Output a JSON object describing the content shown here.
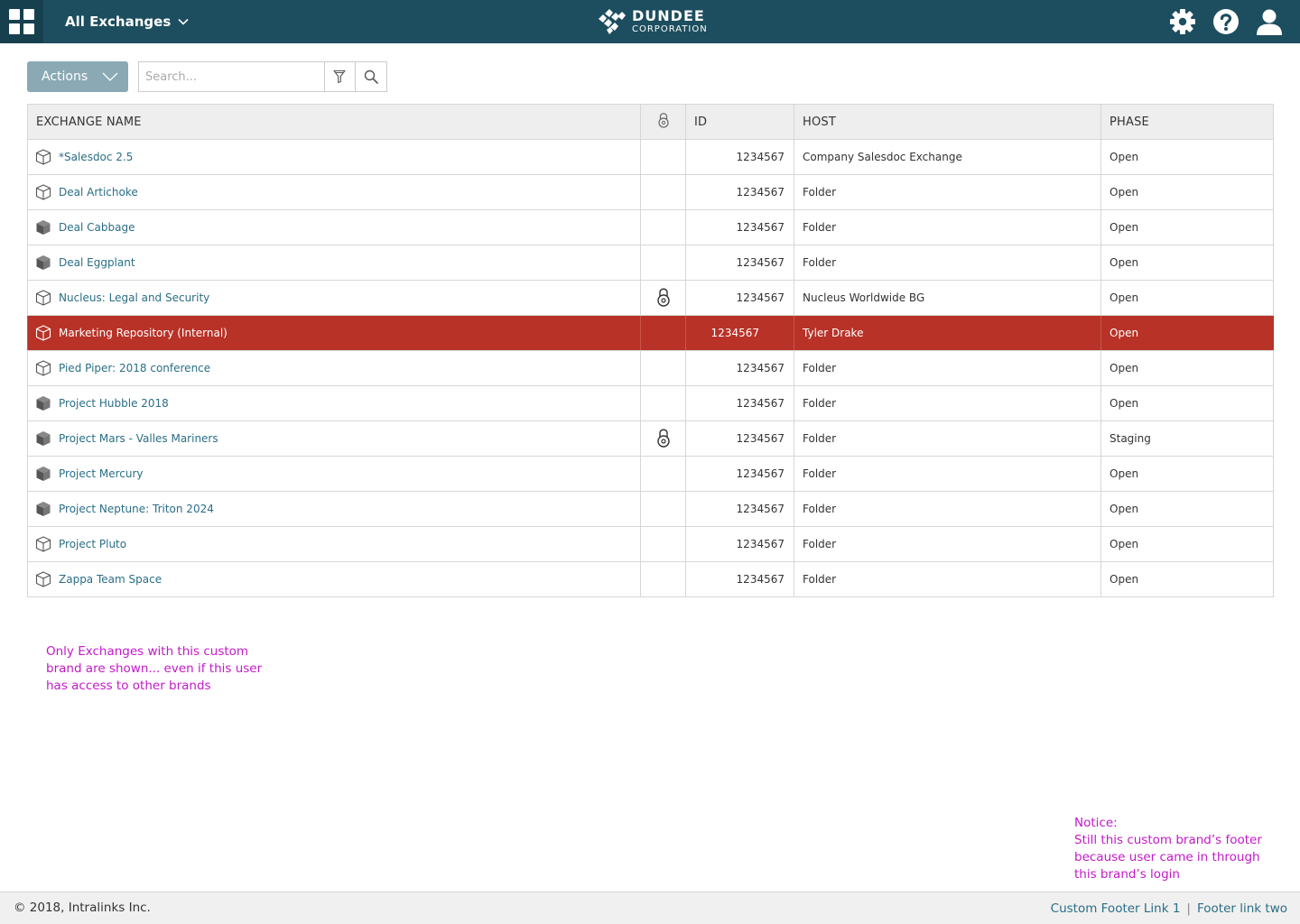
{
  "header": {
    "apps_icon": "apps-grid-icon",
    "exchange_menu_label": "All Exchanges",
    "logo_line1": "DUNDEE",
    "logo_line2": "CORPORATION",
    "icons": [
      "gear-icon",
      "help-icon",
      "user-icon"
    ],
    "bar_color": "#1d4e5f"
  },
  "toolbar": {
    "actions_label": "Actions",
    "search_placeholder": "Search...",
    "search_value": ""
  },
  "table": {
    "columns": {
      "name": "EXCHANGE NAME",
      "lock": "lock-icon",
      "id": "ID",
      "host": "HOST",
      "phase": "PHASE"
    },
    "rows": [
      {
        "name": "*Salesdoc 2.5",
        "icon": "cube-outline-icon",
        "locked": false,
        "id": "1234567",
        "host": "Company Salesdoc Exchange",
        "phase": "Open",
        "selected": false
      },
      {
        "name": "Deal Artichoke",
        "icon": "cube-outline-icon",
        "locked": false,
        "id": "1234567",
        "host": "Folder",
        "phase": "Open",
        "selected": false
      },
      {
        "name": "Deal Cabbage",
        "icon": "cube-filled-icon",
        "locked": false,
        "id": "1234567",
        "host": "Folder",
        "phase": "Open",
        "selected": false
      },
      {
        "name": "Deal Eggplant",
        "icon": "cube-filled-icon",
        "locked": false,
        "id": "1234567",
        "host": "Folder",
        "phase": "Open",
        "selected": false
      },
      {
        "name": "Nucleus: Legal and Security",
        "icon": "cube-outline-icon",
        "locked": true,
        "id": "1234567",
        "host": "Nucleus Worldwide BG",
        "phase": "Open",
        "selected": false
      },
      {
        "name": "Marketing Repository (Internal)",
        "icon": "cube-outline-icon",
        "locked": false,
        "id": "1234567",
        "host": "Tyler Drake",
        "phase": "Open",
        "selected": true
      },
      {
        "name": "Pied Piper: 2018 conference",
        "icon": "cube-outline-icon",
        "locked": false,
        "id": "1234567",
        "host": "Folder",
        "phase": "Open",
        "selected": false
      },
      {
        "name": "Project Hubble 2018",
        "icon": "cube-filled-icon",
        "locked": false,
        "id": "1234567",
        "host": "Folder",
        "phase": "Open",
        "selected": false
      },
      {
        "name": "Project Mars - Valles Mariners",
        "icon": "cube-filled-icon",
        "locked": true,
        "id": "1234567",
        "host": "Folder",
        "phase": "Staging",
        "selected": false
      },
      {
        "name": "Project Mercury",
        "icon": "cube-filled-icon",
        "locked": false,
        "id": "1234567",
        "host": "Folder",
        "phase": "Open",
        "selected": false
      },
      {
        "name": "Project Neptune: Triton 2024",
        "icon": "cube-filled-icon",
        "locked": false,
        "id": "1234567",
        "host": "Folder",
        "phase": "Open",
        "selected": false
      },
      {
        "name": "Project Pluto",
        "icon": "cube-outline-icon",
        "locked": false,
        "id": "1234567",
        "host": "Folder",
        "phase": "Open",
        "selected": false
      },
      {
        "name": "Zappa Team Space",
        "icon": "cube-outline-icon",
        "locked": false,
        "id": "1234567",
        "host": "Folder",
        "phase": "Open",
        "selected": false
      }
    ],
    "selected_row_color": "#b83227",
    "link_color": "#2a6e86"
  },
  "annotations": {
    "note1": "Only Exchanges with this custom brand are shown... even if this user has access to other brands",
    "note2_title": "Notice:",
    "note2_body": "Still this custom brand’s footer because user came in through this brand’s login",
    "color": "#c21ac8"
  },
  "footer": {
    "copyright": "© 2018, Intralinks Inc.",
    "link1": "Custom Footer Link 1",
    "separator": "|",
    "link2": "Footer link two"
  }
}
